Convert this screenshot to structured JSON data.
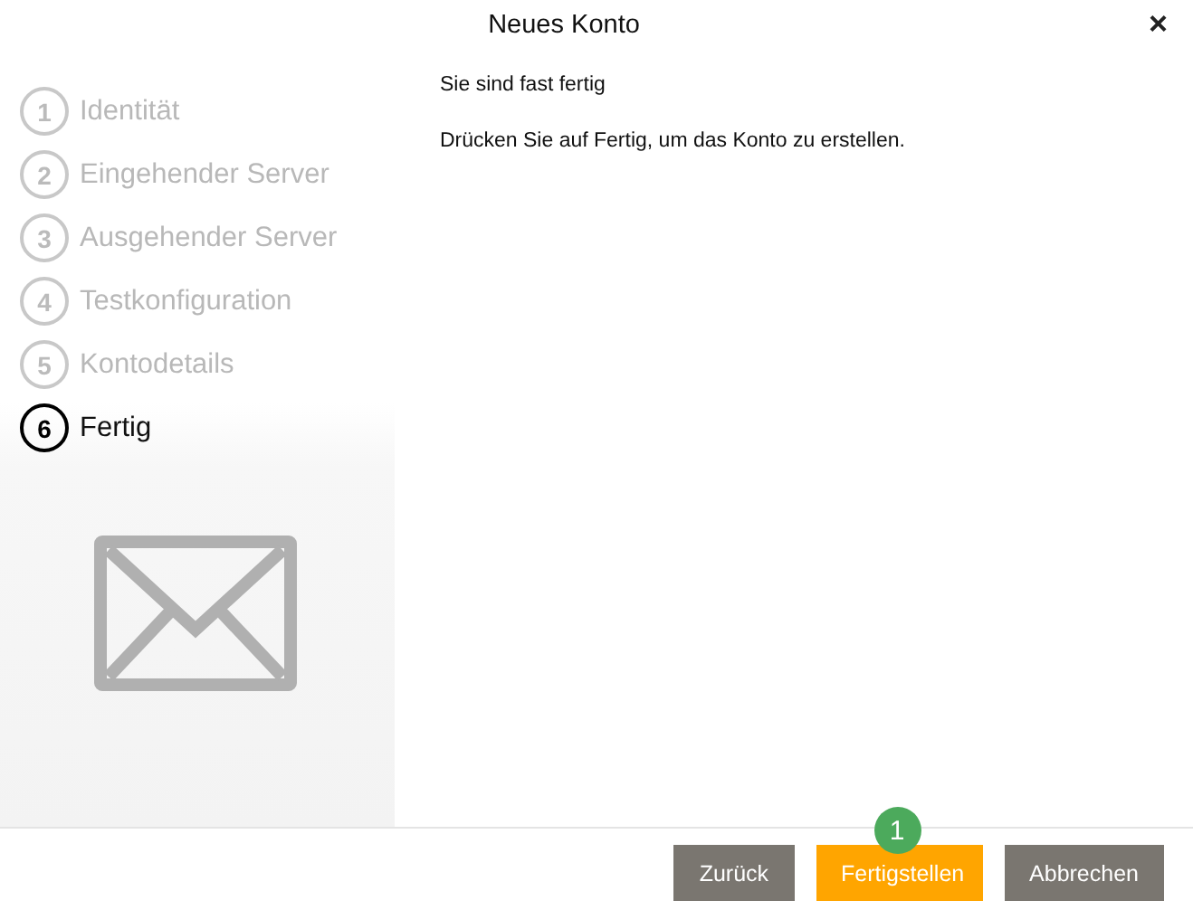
{
  "window": {
    "title": "Neues Konto",
    "close": "×"
  },
  "steps": [
    {
      "number": "1",
      "label": "Identität",
      "selected": false
    },
    {
      "number": "2",
      "label": "Eingehender Server",
      "selected": false
    },
    {
      "number": "3",
      "label": "Ausgehender Server",
      "selected": false
    },
    {
      "number": "4",
      "label": "Testkonfiguration",
      "selected": false
    },
    {
      "number": "5",
      "label": "Kontodetails",
      "selected": false
    },
    {
      "number": "6",
      "label": "Fertig",
      "selected": true
    }
  ],
  "content": {
    "heading": "Sie sind fast fertig",
    "text": "Drücken Sie auf Fertig, um das Konto zu erstellen."
  },
  "buttons": [
    {
      "label": "Zurück",
      "kind": "secondary"
    },
    {
      "label": "Fertigstellen",
      "kind": "primary",
      "badge": "1"
    },
    {
      "label": "Abbrechen",
      "kind": "secondary"
    }
  ]
}
